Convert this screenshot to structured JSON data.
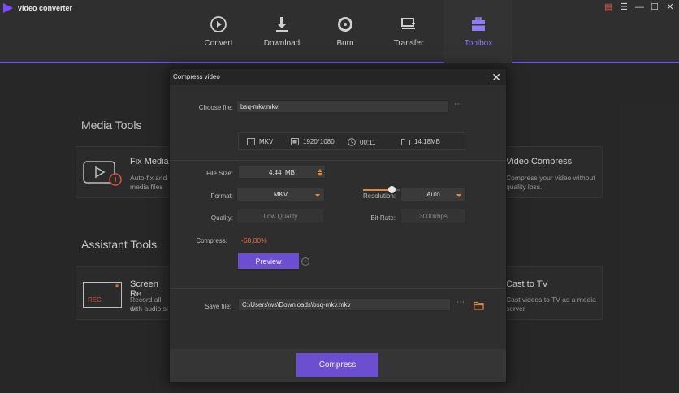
{
  "app": {
    "title": "video converter"
  },
  "nav": {
    "items": [
      {
        "label": "Convert"
      },
      {
        "label": "Download"
      },
      {
        "label": "Burn"
      },
      {
        "label": "Transfer"
      },
      {
        "label": "Toolbox"
      }
    ],
    "active": "Toolbox"
  },
  "background": {
    "media_tools_title": "Media Tools",
    "assistant_tools_title": "Assistant Tools",
    "cards": {
      "fix_media": {
        "name": "Fix Media",
        "desc1": "Auto-fix and",
        "desc2": "media files"
      },
      "video_compress": {
        "name": "Video Compress",
        "desc1": "Compress your video without",
        "desc2": "quality loss."
      },
      "screen_recorder": {
        "name": "Screen Re",
        "desc1": "Record all de",
        "desc2": "with audio si",
        "icon_text": "REC"
      },
      "cast_to_tv": {
        "name": "Cast to TV",
        "desc1": "Cast videos to TV as a media",
        "desc2": "server"
      }
    }
  },
  "dialog": {
    "title": "Compress video",
    "choose_file_label": "Choose file:",
    "choose_file_value": "bsq-mkv.mkv",
    "info": {
      "format": "MKV",
      "resolution": "1920*1080",
      "duration": "00:11",
      "size": "14.18MB"
    },
    "file_size_label": "File Size:",
    "file_size_value": "4.44",
    "file_size_unit": "MB",
    "slider_fraction": 0.28,
    "format_label": "Format:",
    "format_value": "MKV",
    "resolution_label": "Resolution:",
    "resolution_value": "Auto",
    "quality_label": "Quality:",
    "quality_value": "Low Quality",
    "bitrate_label": "Bit Rate:",
    "bitrate_value": "3000kbps",
    "compress_label": "Compress:",
    "compress_value": "-68.00%",
    "preview_label": "Preview",
    "save_file_label": "Save file:",
    "save_file_value": "C:\\Users\\ws\\Downloads\\bsq-mkv.mkv",
    "compress_button": "Compress"
  },
  "colors": {
    "accent": "#6c4fd0",
    "orange": "#e0893d",
    "compress_value": "#e86a4a"
  }
}
